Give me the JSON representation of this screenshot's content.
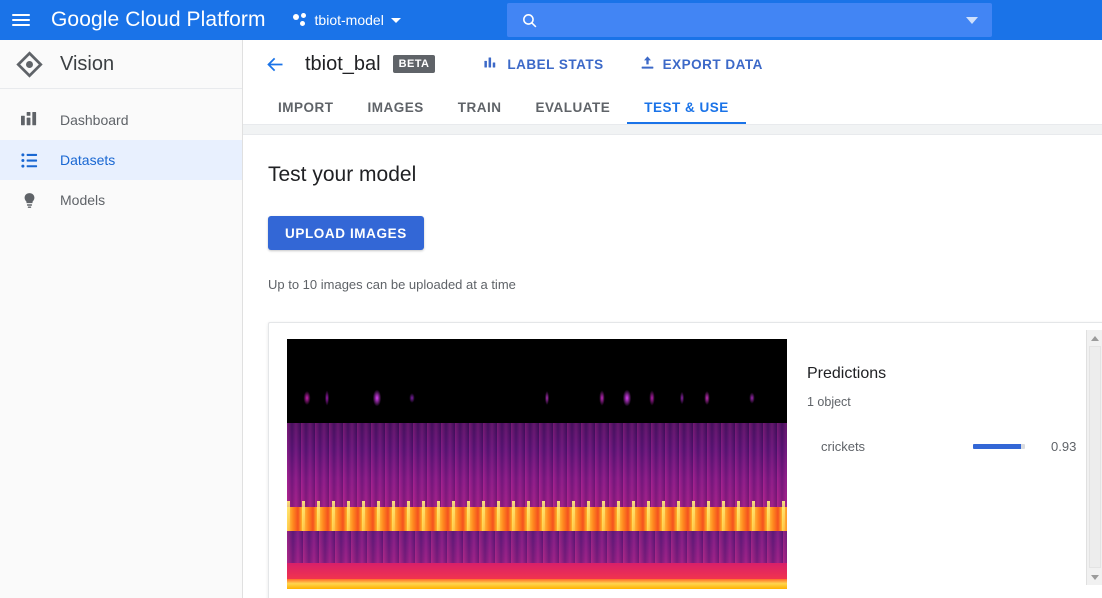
{
  "topbar": {
    "menu_icon": "hamburger-menu-icon",
    "brand": "Google Cloud Platform",
    "project": {
      "icon": "project-dots-icon",
      "name": "tbiot-model",
      "caret": "chevron-down-icon"
    },
    "search": {
      "icon": "search-icon",
      "value": "",
      "placeholder": "",
      "caret": "chevron-down-icon"
    },
    "bg_color": "#1a73e8"
  },
  "sidebar": {
    "product_icon": "vision-diamond-icon",
    "product_name": "Vision",
    "items": [
      {
        "label": "Dashboard",
        "icon": "dashboard-icon",
        "active": false
      },
      {
        "label": "Datasets",
        "icon": "list-icon",
        "active": true
      },
      {
        "label": "Models",
        "icon": "lightbulb-icon",
        "active": false
      }
    ],
    "active_color": "#1967d2",
    "active_bg": "#e8f0fe"
  },
  "page_header": {
    "back_icon": "back-arrow-icon",
    "dataset_name": "tbiot_bal",
    "badge": "BETA",
    "actions": [
      {
        "label": "LABEL STATS",
        "icon": "bar-chart-icon"
      },
      {
        "label": "EXPORT DATA",
        "icon": "upload-export-icon"
      }
    ],
    "action_color": "#3c69c8"
  },
  "tabs": [
    {
      "label": "IMPORT",
      "active": false
    },
    {
      "label": "IMAGES",
      "active": false
    },
    {
      "label": "TRAIN",
      "active": false
    },
    {
      "label": "EVALUATE",
      "active": false
    },
    {
      "label": "TEST & USE",
      "active": true
    }
  ],
  "content": {
    "section_title": "Test your model",
    "upload_button": "UPLOAD IMAGES",
    "upload_hint": "Up to 10 images can be uploaded at a time",
    "button_color": "#3367d6"
  },
  "result": {
    "image_alt": "spectrogram-image",
    "predictions_title": "Predictions",
    "object_count": "1 object",
    "rows": [
      {
        "label": "crickets",
        "score": "0.93",
        "fill_percent": 93
      }
    ],
    "bar_color": "#3367d6",
    "bar_track_color": "#dadce0"
  },
  "scrollbar": {
    "up_icon": "scroll-up-arrow-icon",
    "down_icon": "scroll-down-arrow-icon"
  }
}
